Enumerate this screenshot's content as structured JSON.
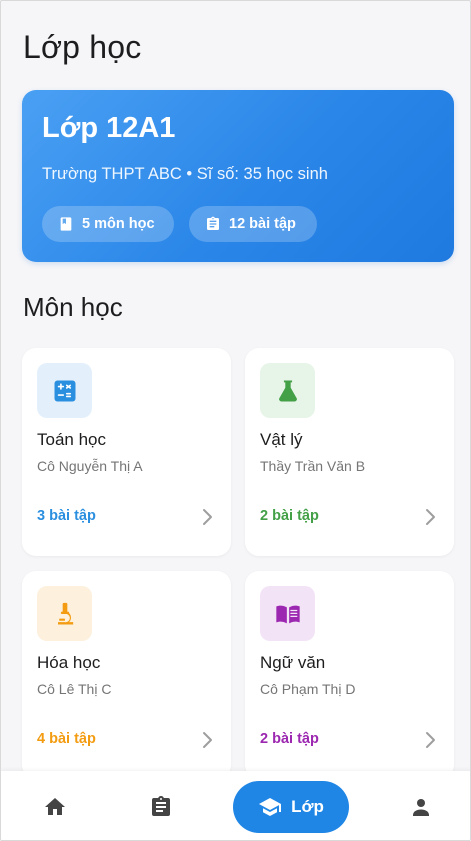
{
  "header": {
    "title": "Lớp học"
  },
  "class_card": {
    "name": "Lớp 12A1",
    "info": "Trường THPT ABC • Sĩ số: 35 học sinh",
    "chips": [
      {
        "label": "5 môn học",
        "icon": "book-icon"
      },
      {
        "label": "12 bài tập",
        "icon": "assignment-icon"
      }
    ],
    "colors": {
      "start": "#4aa0f3",
      "end": "#1f7ae0"
    }
  },
  "section": {
    "title": "Môn học"
  },
  "subjects": [
    {
      "name": "Toán học",
      "teacher": "Cô Nguyễn Thị A",
      "count": "3 bài tập",
      "icon": "calculator-icon",
      "color": "#2b8fe0",
      "bg": "#e3f0fc"
    },
    {
      "name": "Vật lý",
      "teacher": "Thầy Trần Văn B",
      "count": "2 bài tập",
      "icon": "flask-icon",
      "color": "#43a047",
      "bg": "#e7f4e8"
    },
    {
      "name": "Hóa học",
      "teacher": "Cô Lê Thị C",
      "count": "4 bài tập",
      "icon": "microscope-icon",
      "color": "#f39c12",
      "bg": "#fdf0dd"
    },
    {
      "name": "Ngữ văn",
      "teacher": "Cô Phạm Thị D",
      "count": "2 bài tập",
      "icon": "open-book-icon",
      "color": "#9c27b0",
      "bg": "#f3e3f6"
    }
  ],
  "nav": {
    "items": [
      {
        "icon": "home-icon"
      },
      {
        "icon": "assignment-icon"
      },
      {
        "icon": "school-icon",
        "label": "Lớp",
        "active": true
      },
      {
        "icon": "person-icon"
      }
    ],
    "active_color": "#1f86e6"
  }
}
